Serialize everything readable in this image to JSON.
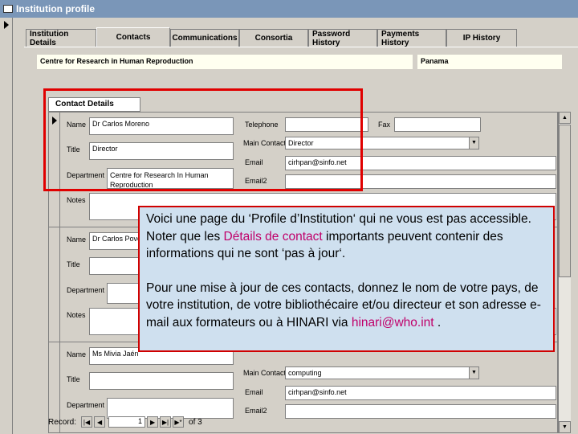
{
  "window": {
    "title": "Institution profile"
  },
  "tabs": [
    {
      "label": "Institution Details",
      "active": false
    },
    {
      "label": "Contacts",
      "active": true
    },
    {
      "label": "Communications",
      "active": false
    },
    {
      "label": "Consortia",
      "active": false
    },
    {
      "label": "Password History",
      "active": false
    },
    {
      "label": "Payments History",
      "active": false
    },
    {
      "label": "IP History",
      "active": false
    }
  ],
  "header": {
    "institution": "Centre for Research in Human Reproduction",
    "country": "Panama"
  },
  "subform": {
    "label": "Contact Details"
  },
  "labels": {
    "name": "Name",
    "title": "Title",
    "department": "Department",
    "notes": "Notes",
    "telephone": "Telephone",
    "fax": "Fax",
    "main_contact": "Main Contact",
    "email": "Email",
    "email2": "Email2"
  },
  "records": [
    {
      "name": "Dr Carlos Moreno",
      "title": "Director",
      "department": "Centre for Research In Human Reproduction",
      "telephone": "",
      "fax": "",
      "main_contact": "Director",
      "email": "cirhpan@sinfo.net",
      "email2": "",
      "notes": ""
    },
    {
      "name": "Dr Carlos Poved",
      "title": "",
      "department": "",
      "notes": ""
    },
    {
      "name": "Ms Mivia Jaén",
      "title": "",
      "department": "",
      "main_contact": "computing",
      "email": "cirhpan@sinfo.net",
      "email2": ""
    }
  ],
  "navigation": {
    "record_label": "Record:",
    "current": "1",
    "of_label": "of 3"
  },
  "callout": {
    "p1_before": "Voici une page du ‘Profile d’Institution‘ qui ne vous est pas accessible.  Noter que les ",
    "p1_highlight": "Détails de contact",
    "p1_after": " importants peuvent contenir des informations qui ne sont  ‘pas à jour‘.",
    "p2_before": "Pour une mise à jour de ces contacts, donnez le nom de votre pays, de votre institution, de votre bibliothécaire et/ou directeur et son adresse e-mail aux formateurs ou à HINARI via ",
    "p2_link": "hinari@who.int",
    "p2_after": " ."
  },
  "colors": {
    "highlight": "#c0006a",
    "callout_border": "#d00000",
    "red_box": "#e00000"
  }
}
